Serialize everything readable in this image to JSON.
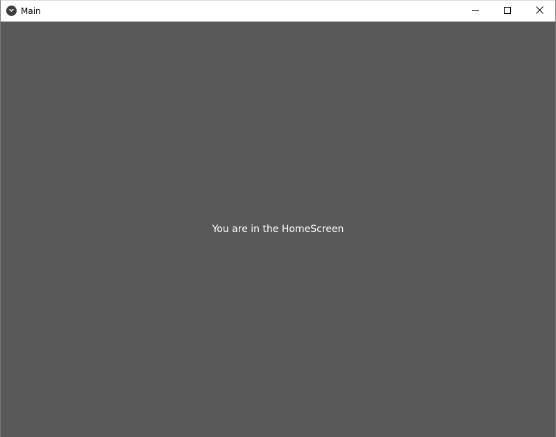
{
  "window": {
    "title": "Main",
    "icon": "kivy-app-icon",
    "controls": {
      "minimize": "minimize-icon",
      "maximize": "maximize-icon",
      "close": "close-icon"
    }
  },
  "main": {
    "message": "You are in the HomeScreen"
  },
  "colors": {
    "background": "#595959",
    "text": "#ffffff",
    "titlebar": "#ffffff"
  }
}
